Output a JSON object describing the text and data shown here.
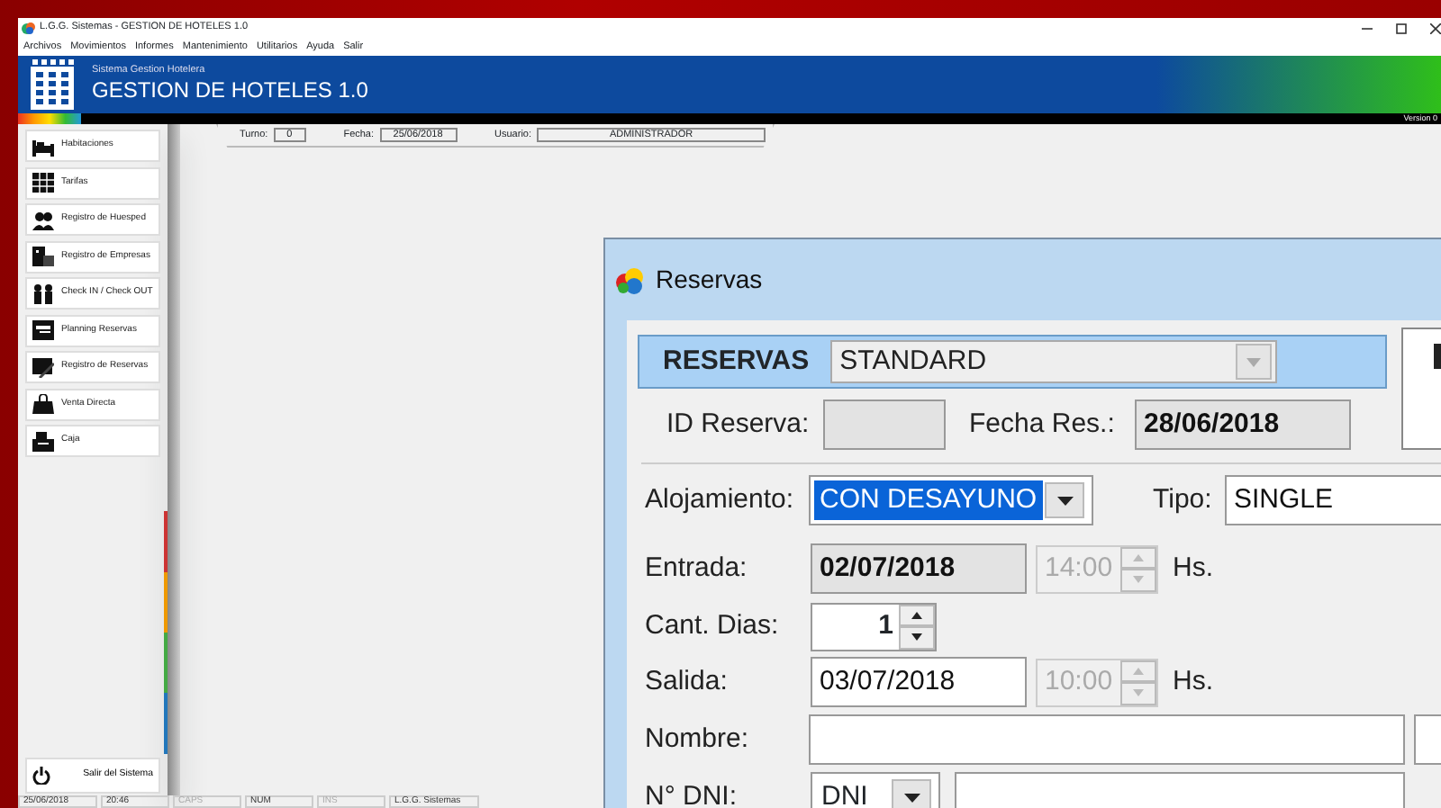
{
  "window": {
    "title": "L.G.G. Sistemas - GESTION DE HOTELES 1.0"
  },
  "menu": [
    "Archivos",
    "Movimientos",
    "Informes",
    "Mantenimiento",
    "Utilitarios",
    "Ayuda",
    "Salir"
  ],
  "header": {
    "subtitle": "Sistema Gestion Hotelera",
    "title": "GESTION DE HOTELES 1.0",
    "version": "Version 0"
  },
  "session": [
    {
      "label": "Turno:",
      "value": "0"
    },
    {
      "label": "Fecha:",
      "value": "25/06/2018"
    },
    {
      "label": "Usuario:",
      "value": "ADMINISTRADOR"
    }
  ],
  "sidebar": {
    "items": [
      "Habitaciones",
      "Tarifas",
      "Registro de Huesped",
      "Registro de Empresas",
      "Check IN / Check OUT",
      "Planning Reservas",
      "Registro de Reservas",
      "Venta Directa",
      "Caja"
    ],
    "exit": "Salir del Sistema"
  },
  "status_bar": [
    {
      "text": "25/06/2018",
      "disabled": false
    },
    {
      "text": "20:46",
      "disabled": false
    },
    {
      "text": "CAPS",
      "disabled": true
    },
    {
      "text": "NUM",
      "disabled": false
    },
    {
      "text": "INS",
      "disabled": true
    },
    {
      "text": "L.G.G. Sistemas",
      "disabled": false
    }
  ],
  "dialog": {
    "title": "Reservas",
    "header": {
      "label": "RESERVAS",
      "value": "STANDARD",
      "disabled": true
    },
    "rows": [
      {
        "items": [
          {
            "kind": "label",
            "text": "ID Reserva:"
          },
          {
            "kind": "field",
            "disabled": true
          },
          {
            "kind": "label",
            "text": "Fecha Res.:"
          },
          {
            "kind": "field",
            "value": "28/06/2018",
            "disabled": true,
            "bold": true
          }
        ]
      },
      {
        "items": [
          {
            "kind": "label",
            "text": "Alojamiento:"
          },
          {
            "kind": "select",
            "value": "CON DESAYUNO",
            "selected": true
          },
          {
            "kind": "label",
            "text": "Tipo:"
          },
          {
            "kind": "field",
            "value": "SINGLE",
            "disabled": false,
            "bold": false
          }
        ]
      },
      {
        "items": [
          {
            "kind": "label",
            "text": "Entrada:"
          },
          {
            "kind": "field",
            "value": "02/07/2018",
            "disabled": true,
            "bold": true
          },
          {
            "kind": "spinner",
            "value": "14:00",
            "disabled": true
          },
          {
            "kind": "label",
            "text": "Hs."
          }
        ]
      },
      {
        "items": [
          {
            "kind": "label",
            "text": "Cant. Dias:"
          },
          {
            "kind": "spinner",
            "value": "1",
            "disabled": false
          }
        ]
      },
      {
        "items": [
          {
            "kind": "label",
            "text": "Salida:"
          },
          {
            "kind": "field",
            "value": "03/07/2018",
            "disabled": false,
            "bold": false
          },
          {
            "kind": "spinner",
            "value": "10:00",
            "disabled": true
          },
          {
            "kind": "label",
            "text": "Hs."
          }
        ]
      },
      {
        "items": [
          {
            "kind": "label",
            "text": "Nombre:"
          },
          {
            "kind": "field",
            "disabled": false
          },
          {
            "kind": "field",
            "disabled": false
          }
        ]
      },
      {
        "items": [
          {
            "kind": "label",
            "text": "N° DNI:"
          },
          {
            "kind": "select",
            "value": "DNI",
            "selected": false
          },
          {
            "kind": "field",
            "disabled": false
          }
        ]
      }
    ]
  }
}
